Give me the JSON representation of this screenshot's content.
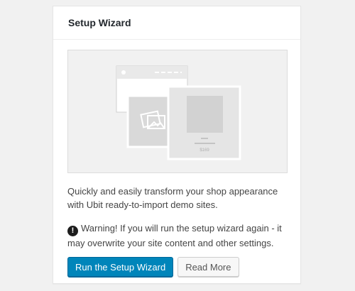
{
  "panel": {
    "title": "Setup Wizard",
    "description": "Quickly and easily transform your shop appearance with Ubit ready-to-import demo sites.",
    "warning_icon": "exclamation-circle-icon",
    "warning_text": "Warning! If you will run the setup wizard again - it may overwrite your site content and other settings.",
    "primary_button": "Run the Setup Wizard",
    "secondary_button": "Read More"
  },
  "illustration": {
    "product_label": "$169"
  },
  "colors": {
    "primary": "#0085ba",
    "background": "#f1f1f1"
  }
}
